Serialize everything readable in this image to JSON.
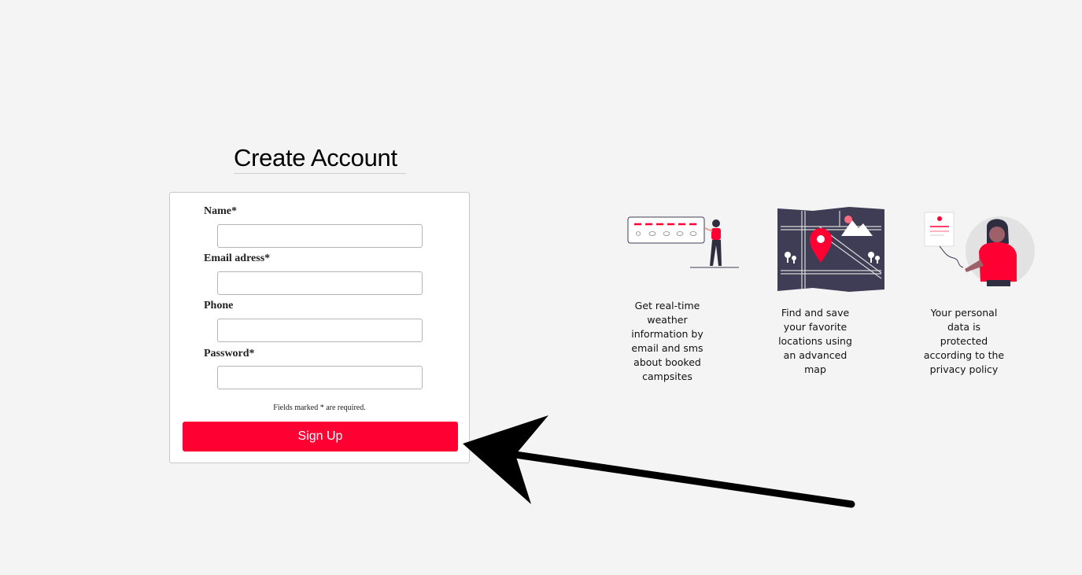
{
  "page": {
    "title": "Create Account"
  },
  "form": {
    "fields": [
      {
        "label": "Name*",
        "value": "",
        "placeholder": ""
      },
      {
        "label": "Email adress*",
        "value": "",
        "placeholder": ""
      },
      {
        "label": "Phone",
        "value": "",
        "placeholder": ""
      },
      {
        "label": "Password*",
        "value": "",
        "placeholder": ""
      }
    ],
    "required_note": "Fields marked * are required.",
    "submit_label": "Sign Up"
  },
  "features": [
    {
      "icon": "weather-notification-illustration",
      "text": "Get real-time weather information by email and sms about booked campsites"
    },
    {
      "icon": "map-location-illustration",
      "text": "Find and save your favorite locations using an advanced map"
    },
    {
      "icon": "privacy-protection-illustration",
      "text": "Your personal data is protected according to the privacy policy"
    }
  ],
  "colors": {
    "accent": "#ff0033",
    "dark": "#3f3d56",
    "background": "#f4f4f4"
  }
}
